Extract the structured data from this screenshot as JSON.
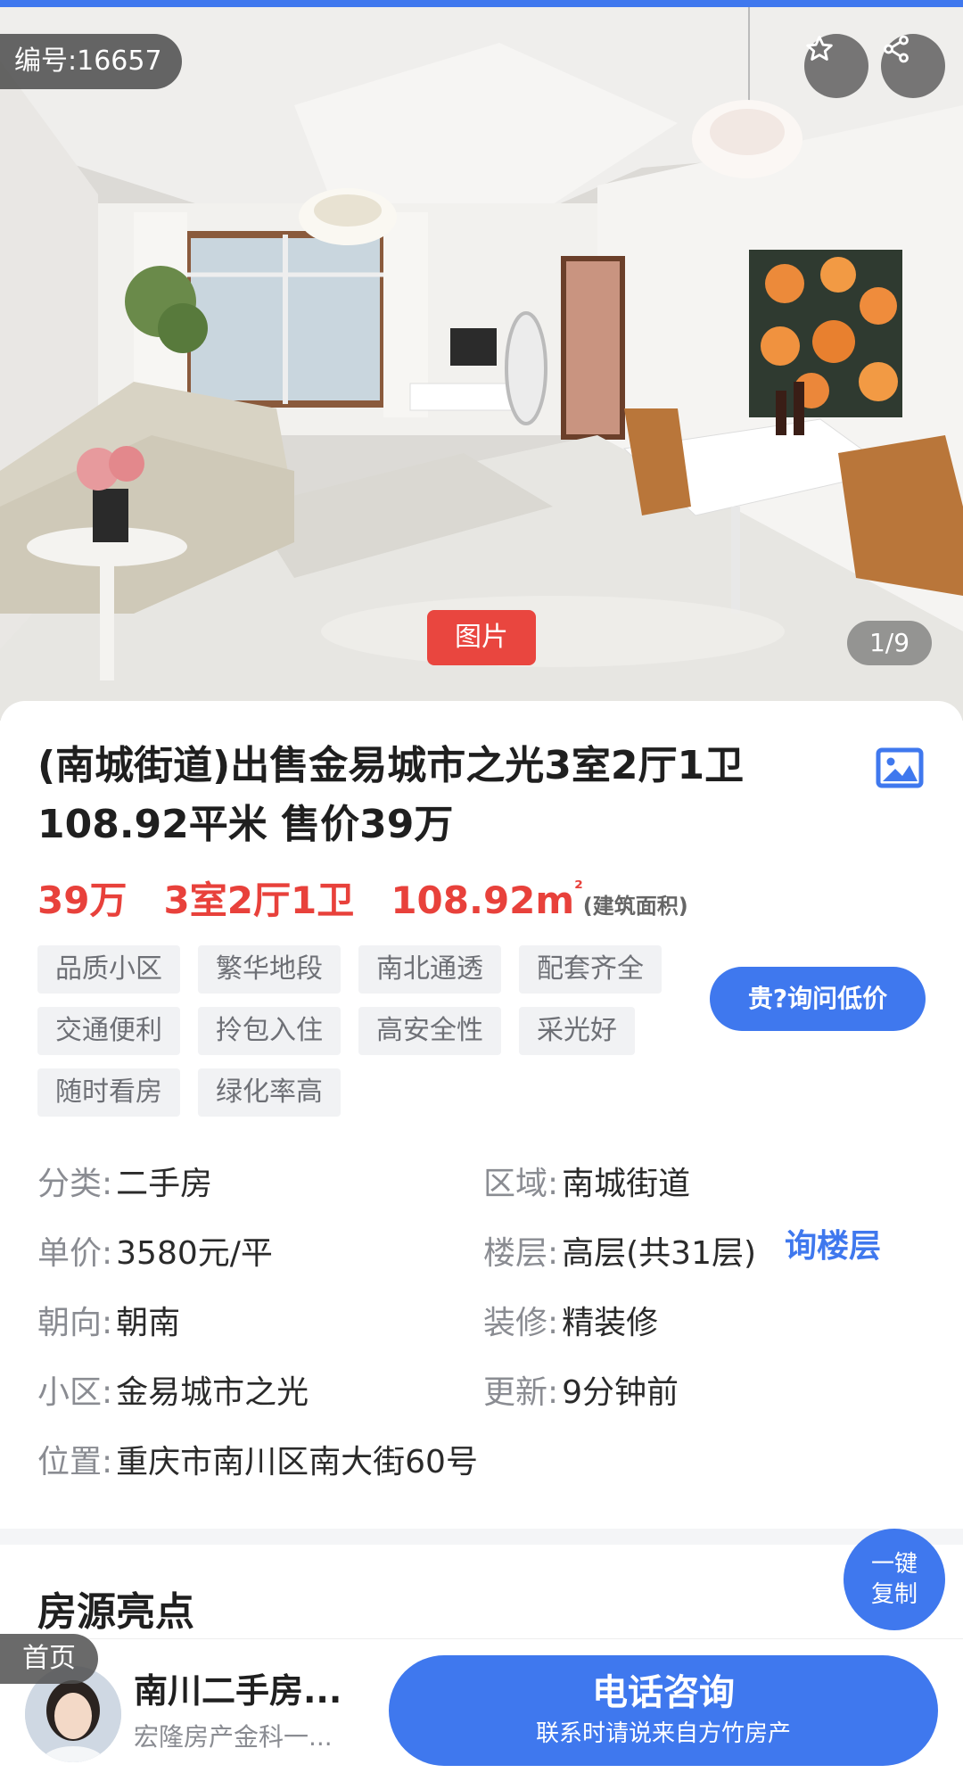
{
  "hero": {
    "listing_id": "编号:16657",
    "favorite_icon": "star-icon",
    "share_icon": "share-icon",
    "photo_tag": "图片",
    "photo_counter": "1/9"
  },
  "listing": {
    "title": "(南城街道)出售金易城市之光3室2厅1卫108.92平米 售价39万",
    "picture_icon": "image-icon",
    "price": "39万",
    "layout": "3室2厅1卫",
    "area": "108.92m",
    "area_sup": "²",
    "area_note": "(建筑面积)",
    "tags": [
      "品质小区",
      "繁华地段",
      "南北通透",
      "配套齐全",
      "交通便利",
      "拎包入住",
      "高安全性",
      "采光好",
      "随时看房",
      "绿化率高"
    ],
    "ask_price_button": "贵?询问低价"
  },
  "details": {
    "category_label": "分类:",
    "category_value": "二手房",
    "region_label": "区域:",
    "region_value": "南城街道",
    "unit_price_label": "单价:",
    "unit_price_value": "3580元/平",
    "floor_label": "楼层:",
    "floor_value": "高层(共31层)",
    "ask_floor": "询楼层",
    "orientation_label": "朝向:",
    "orientation_value": "朝南",
    "decoration_label": "装修:",
    "decoration_value": "精装修",
    "community_label": "小区:",
    "community_value": "金易城市之光",
    "updated_label": "更新:",
    "updated_value": "9分钟前",
    "location_label": "位置:",
    "location_value": "重庆市南川区南大街60号"
  },
  "highlights": {
    "title": "房源亮点"
  },
  "copy_button": {
    "line1": "一键",
    "line2": "复制"
  },
  "bottom_bar": {
    "home_tab": "首页",
    "agent_name": "南川二手房...",
    "agent_company": "宏隆房产金科一...",
    "call_main": "电话咨询",
    "call_sub": "联系时请说来自方竹房产"
  },
  "colors": {
    "accent_blue": "#3f78ee",
    "price_red": "#e8413b",
    "tag_bg": "#f1f2f4"
  }
}
